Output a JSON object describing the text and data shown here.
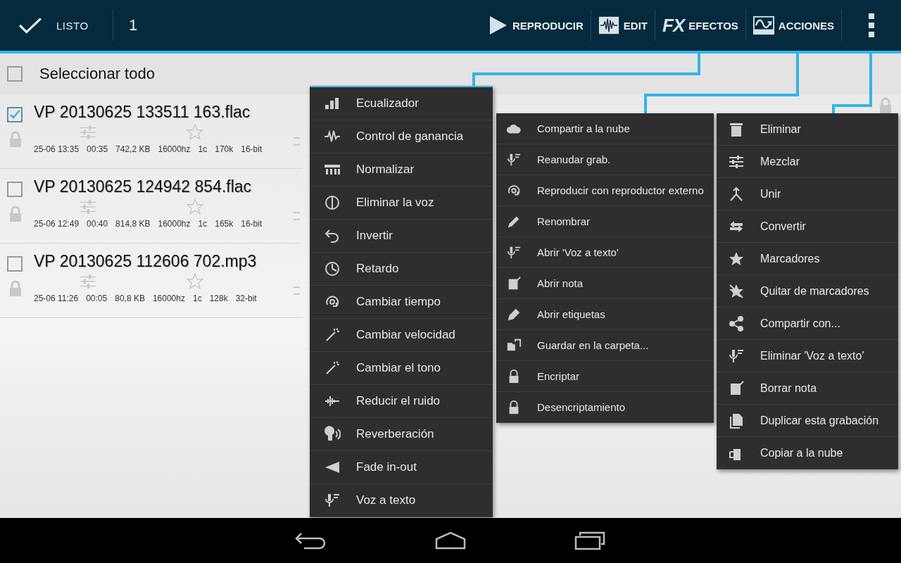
{
  "action_bar": {
    "done_label": "LISTO",
    "selected_count": "1",
    "actions": [
      {
        "kind": "play",
        "label": "REPRODUCIR"
      },
      {
        "kind": "edit",
        "label": "EDIT"
      },
      {
        "kind": "fx",
        "label": "EFECTOS",
        "icon_text": "FX"
      },
      {
        "kind": "actions",
        "label": "ACCIONES"
      }
    ]
  },
  "select_all": {
    "label": "Seleccionar todo",
    "checked": false
  },
  "recordings": [
    {
      "name": "VP 20130625 133511 163.flac",
      "checked": true,
      "meta": [
        "25-06 13:35",
        "00:35",
        "742,2 KB",
        "16000hz",
        "1c",
        "170k",
        "16-bit"
      ]
    },
    {
      "name": "VP 20130625 124942 854.flac",
      "checked": false,
      "meta": [
        "25-06 12:49",
        "00:40",
        "814,8 KB",
        "16000hz",
        "1c",
        "165k",
        "16-bit"
      ]
    },
    {
      "name": "VP 20130625 112606 702.mp3",
      "checked": false,
      "meta": [
        "25-06 11:26",
        "00:05",
        "80,8 KB",
        "16000hz",
        "1c",
        "128k",
        "32-bit"
      ]
    }
  ],
  "menus": [
    {
      "kind": "effects",
      "items": [
        "Ecualizador",
        "Control de ganancia",
        "Normalizar",
        "Eliminar la voz",
        "Invertir",
        "Retardo",
        "Cambiar tiempo",
        "Cambiar velocidad",
        "Cambiar el tono",
        "Reducir el ruido",
        "Reverberación",
        "Fade in-out",
        "Voz a texto"
      ]
    },
    {
      "kind": "actions",
      "items": [
        "Compartir a la nube",
        "Reanudar grab.",
        "Reproducir con reproductor externo",
        "Renombrar",
        "Abrir 'Voz a texto'",
        "Abrir nota",
        "Abrir etiquetas",
        "Guardar en la carpeta...",
        "Encriptar",
        "Desencriptamiento"
      ]
    },
    {
      "kind": "overflow",
      "items": [
        "Eliminar",
        "Mezclar",
        "Unir",
        "Convertir",
        "Marcadores",
        "Quitar de marcadores",
        "Compartir con...",
        "Eliminar 'Voz a texto'",
        "Borrar nota",
        "Duplicar esta grabación",
        "Copiar a la nube"
      ]
    }
  ]
}
